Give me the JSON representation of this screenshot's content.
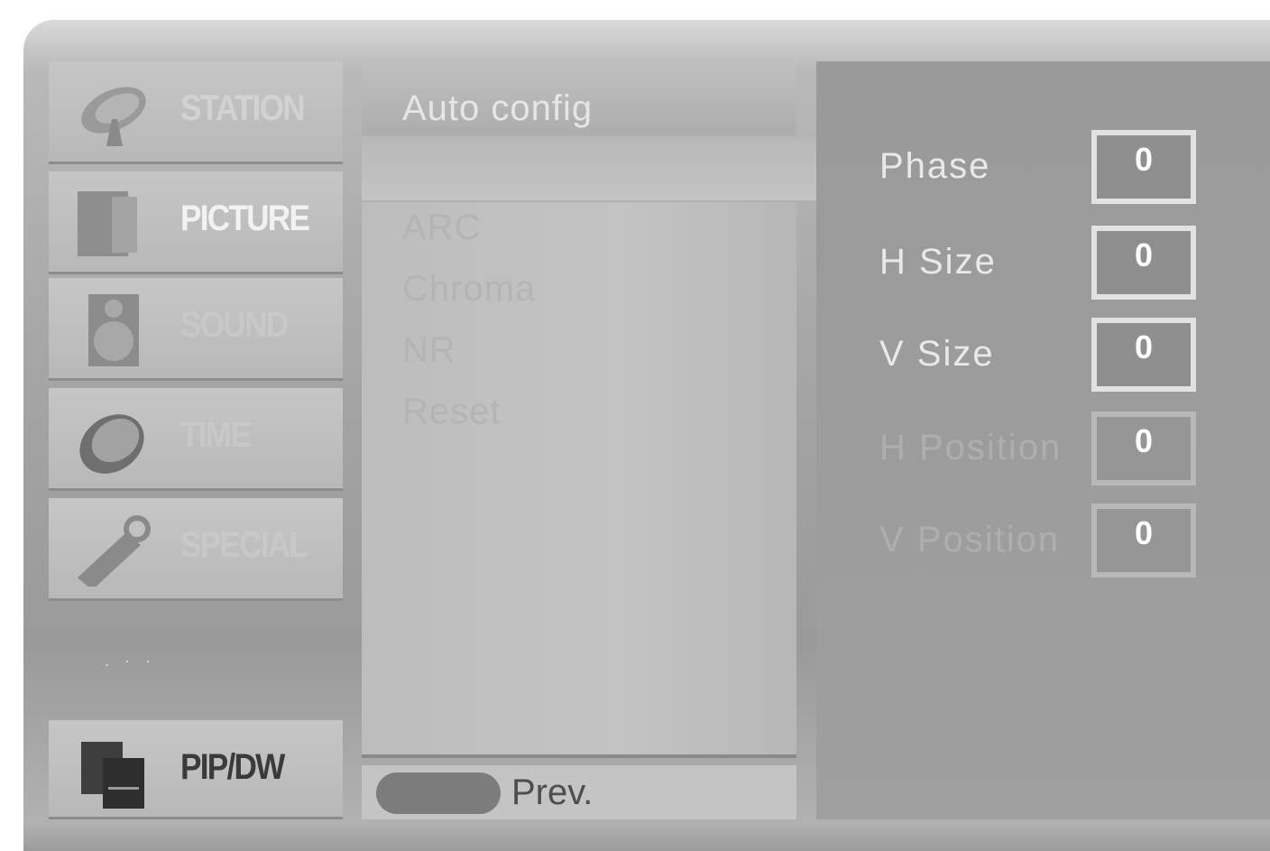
{
  "menu": {
    "items": [
      {
        "label": "STATION",
        "icon": "satellite-dish-icon"
      },
      {
        "label": "PICTURE",
        "icon": "monitor-icon"
      },
      {
        "label": "SOUND",
        "icon": "speaker-icon"
      },
      {
        "label": "TIME",
        "icon": "clock-icon"
      },
      {
        "label": "SPECIAL",
        "icon": "key-tag-icon"
      },
      {
        "label": "PIP/DW",
        "icon": "pip-windows-icon"
      }
    ],
    "active_index": 1
  },
  "submenu": {
    "items": [
      "Auto config",
      "",
      "ARC",
      "Chroma",
      "NR",
      "Reset"
    ],
    "footer_prev": "Prev."
  },
  "options": [
    {
      "label": "Phase",
      "value": "0"
    },
    {
      "label": "H Size",
      "value": "0"
    },
    {
      "label": "V Size",
      "value": "0"
    },
    {
      "label": "H Position",
      "value": "0"
    },
    {
      "label": "V Position",
      "value": "0"
    }
  ],
  "colors": {
    "panel": "#a6a6a6",
    "highlight_text": "#e9e9e9",
    "value_box_border": "#e2e2e2"
  }
}
